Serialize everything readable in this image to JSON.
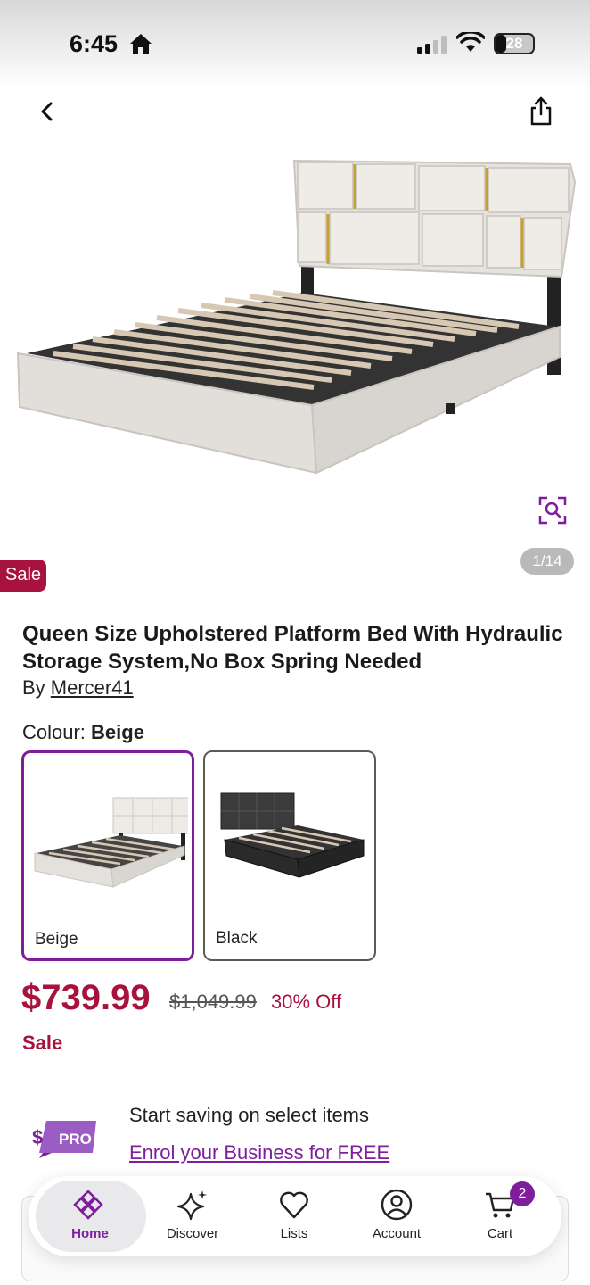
{
  "status_bar": {
    "time": "6:45",
    "battery": "28"
  },
  "product": {
    "image_counter": "1/14",
    "sale_badge": "Sale",
    "title": "Queen Size Upholstered Platform Bed With Hydraulic Storage System,No Box Spring Needed",
    "brand_prefix": "By ",
    "brand": "Mercer41",
    "colour_label": "Colour: ",
    "colour_value": "Beige",
    "swatches": [
      {
        "label": "Beige",
        "selected": true
      },
      {
        "label": "Black",
        "selected": false
      }
    ],
    "price": "$739.99",
    "original_price": "$1,049.99",
    "discount": "30% Off",
    "sale_label": "Sale"
  },
  "pro_banner": {
    "logo_text": "PRO",
    "headline": "Start saving on select items",
    "link": "Enrol your Business for FREE"
  },
  "tab_bar": {
    "home": "Home",
    "discover": "Discover",
    "lists": "Lists",
    "account": "Account",
    "cart": "Cart",
    "cart_count": "2"
  },
  "colors": {
    "accent": "#7f1e9c",
    "sale": "#a8123e"
  }
}
